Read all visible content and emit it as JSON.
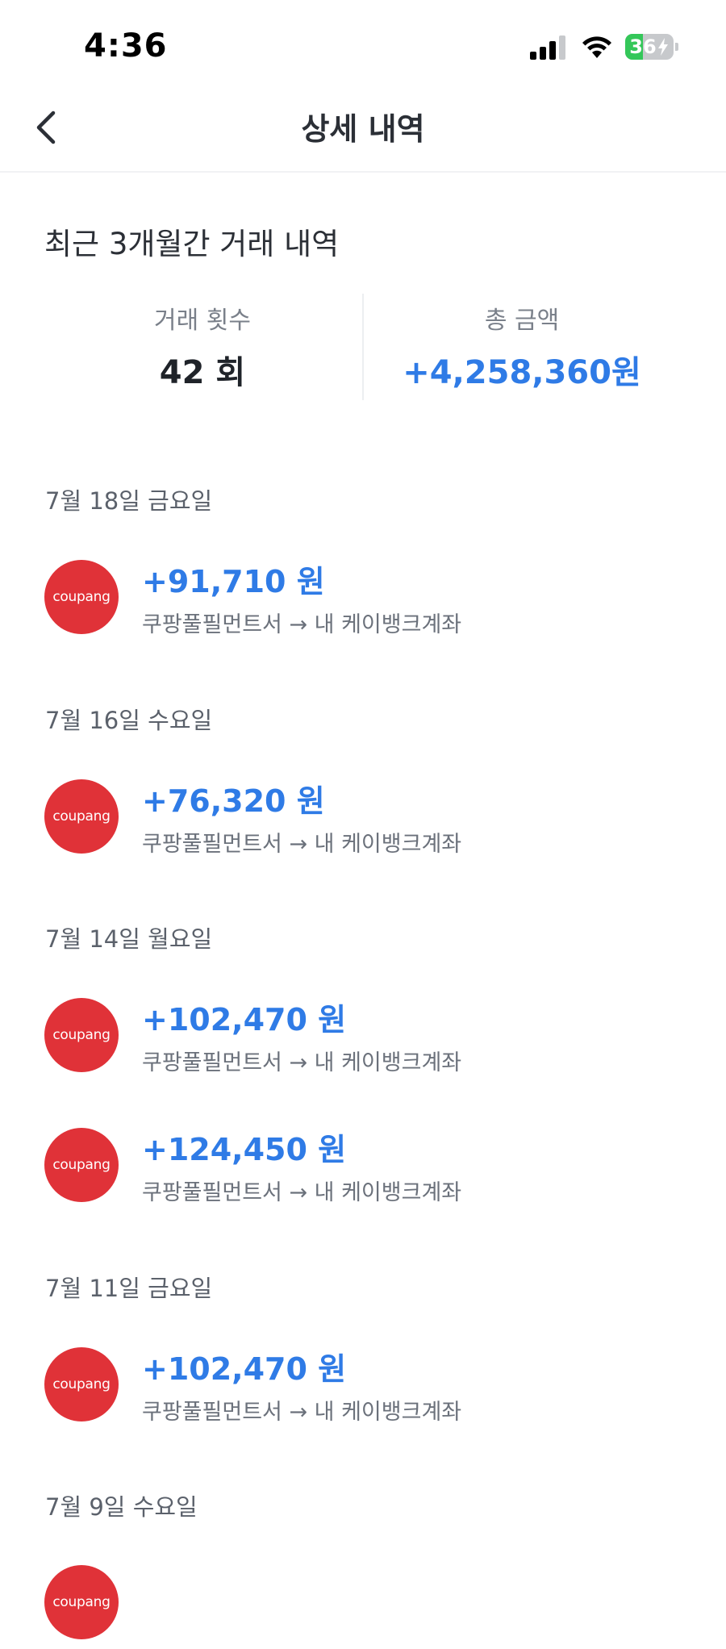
{
  "status_bar": {
    "time": "4:36",
    "battery": "36",
    "battery_level": 0.36,
    "icons": [
      "signal-icon",
      "wifi-icon",
      "battery-charging-icon"
    ]
  },
  "nav": {
    "title": "상세 내역",
    "back_icon": "chevron-left-icon"
  },
  "summary": {
    "period_title": "최근 3개월간 거래 내역",
    "count_label": "거래 횟수",
    "count_value": "42 회",
    "total_label": "총 금액",
    "total_value": "+4,258,360원"
  },
  "colors": {
    "accent": "#2f7be6",
    "coupang_red": "#e03238",
    "battery_green": "#34c759"
  },
  "groups": [
    {
      "date": "7월 18일 금요일",
      "items": [
        {
          "logo": "coupang",
          "amount": "+91,710 원",
          "desc": "쿠팡풀필먼트서 → 내 케이뱅크계좌"
        }
      ]
    },
    {
      "date": "7월 16일 수요일",
      "items": [
        {
          "logo": "coupang",
          "amount": "+76,320 원",
          "desc": "쿠팡풀필먼트서 → 내 케이뱅크계좌"
        }
      ]
    },
    {
      "date": "7월 14일 월요일",
      "items": [
        {
          "logo": "coupang",
          "amount": "+102,470 원",
          "desc": "쿠팡풀필먼트서 → 내 케이뱅크계좌"
        },
        {
          "logo": "coupang",
          "amount": "+124,450 원",
          "desc": "쿠팡풀필먼트서 → 내 케이뱅크계좌"
        }
      ]
    },
    {
      "date": "7월 11일 금요일",
      "items": [
        {
          "logo": "coupang",
          "amount": "+102,470 원",
          "desc": "쿠팡풀필먼트서 → 내 케이뱅크계좌"
        }
      ]
    },
    {
      "date": "7월 9일 수요일",
      "items": [
        {
          "logo": "coupang",
          "amount": "",
          "desc": ""
        }
      ]
    }
  ]
}
